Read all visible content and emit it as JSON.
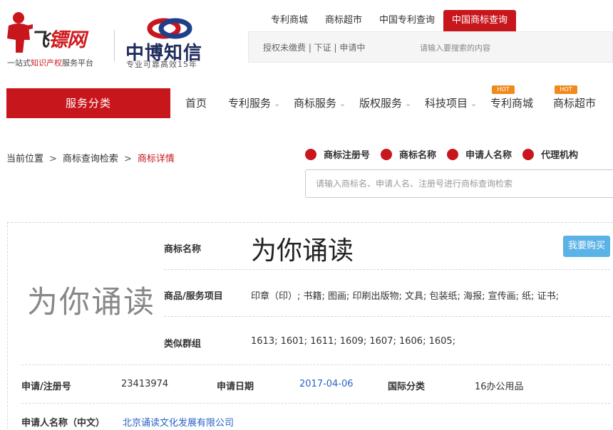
{
  "logo1": {
    "brand_black": "飞",
    "brand_red": "镖网",
    "slogan_pre": "一站式",
    "slogan_red": "知识产权",
    "slogan_post": "服务平台"
  },
  "logo2": {
    "brand": "中博知信",
    "sub": "专业可靠高效15年"
  },
  "top_links": [
    "专利商城",
    "商标超市",
    "中国专利查询",
    "中国商标查询"
  ],
  "sub_links": "授权未缴费 | 下证 | 申请中",
  "sub_placeholder": "请输入要搜索的内容",
  "category_button": "服务分类",
  "nav": {
    "home": "首页",
    "patent": "专利服务",
    "trademark": "商标服务",
    "copyright": "版权服务",
    "tech": "科技项目",
    "patent_mall": "专利商城",
    "tm_market": "商标超市",
    "hot": "HOT"
  },
  "breadcrumb": {
    "home": "当前位置",
    "search": "商标查询检索",
    "current": "商标详情",
    "sep": ">"
  },
  "search_types": [
    "商标注册号",
    "商标名称",
    "申请人名称",
    "代理机构"
  ],
  "search_placeholder": "请输入商标名、申请人名、注册号进行商标查询检索",
  "detail": {
    "image_text": "为你诵读",
    "name_label": "商标名称",
    "name": "为你诵读",
    "buy": "我要购买",
    "goods_label": "商品/服务项目",
    "goods": "印章（印）; 书籍; 图画; 印刷出版物; 文具; 包装纸; 海报; 宣传画; 纸; 证书;",
    "groups_label": "类似群组",
    "groups": "1613; 1601; 1611; 1609; 1607; 1606; 1605;",
    "regno_label": "申请/注册号",
    "regno": "23413974",
    "date_label": "申请日期",
    "date": "2017-04-06",
    "class_label": "国际分类",
    "class": "16办公用品",
    "applicant_label": "申请人名称（中文）",
    "applicant": "北京诵读文化发展有限公司"
  },
  "colors": {
    "brand_red": "#c8161d",
    "hot_orange": "#f08a1c",
    "buy_blue": "#5bb2e6",
    "link_blue": "#2a62c9"
  },
  "icons": {
    "chevron": "chevron-down-icon",
    "dot": "red-dot-icon"
  }
}
